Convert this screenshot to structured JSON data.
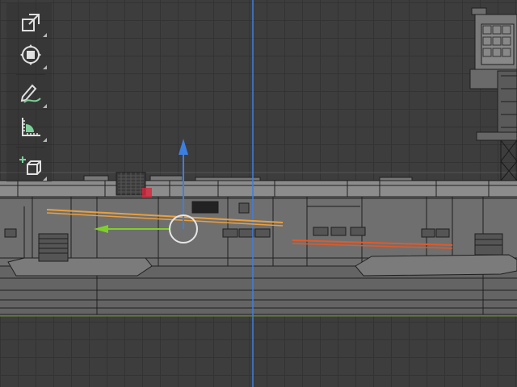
{
  "app": {
    "accent": "#5f8fd6",
    "background": "#3d3d3d"
  },
  "toolbar": {
    "tools": [
      {
        "id": "scale",
        "icon": "scale-icon"
      },
      {
        "id": "transform",
        "icon": "transform-icon"
      },
      {
        "id": "annotate",
        "icon": "annotate-icon"
      },
      {
        "id": "measure",
        "icon": "measure-icon"
      },
      {
        "id": "add-cube",
        "icon": "add-cube-icon"
      }
    ]
  },
  "gizmo": {
    "x_axis_color": "#7fcf2a",
    "z_axis_color": "#3d7fe0",
    "ring_color": "#e6e6e6"
  },
  "selection": {
    "edge_colors": [
      "#e8a040",
      "#e05a2a"
    ],
    "active_face_color": "#d8263c"
  },
  "axes": {
    "vertical_axis_color": "#3d7fe0",
    "horizontal_axis_color": "#6a8a3a"
  }
}
